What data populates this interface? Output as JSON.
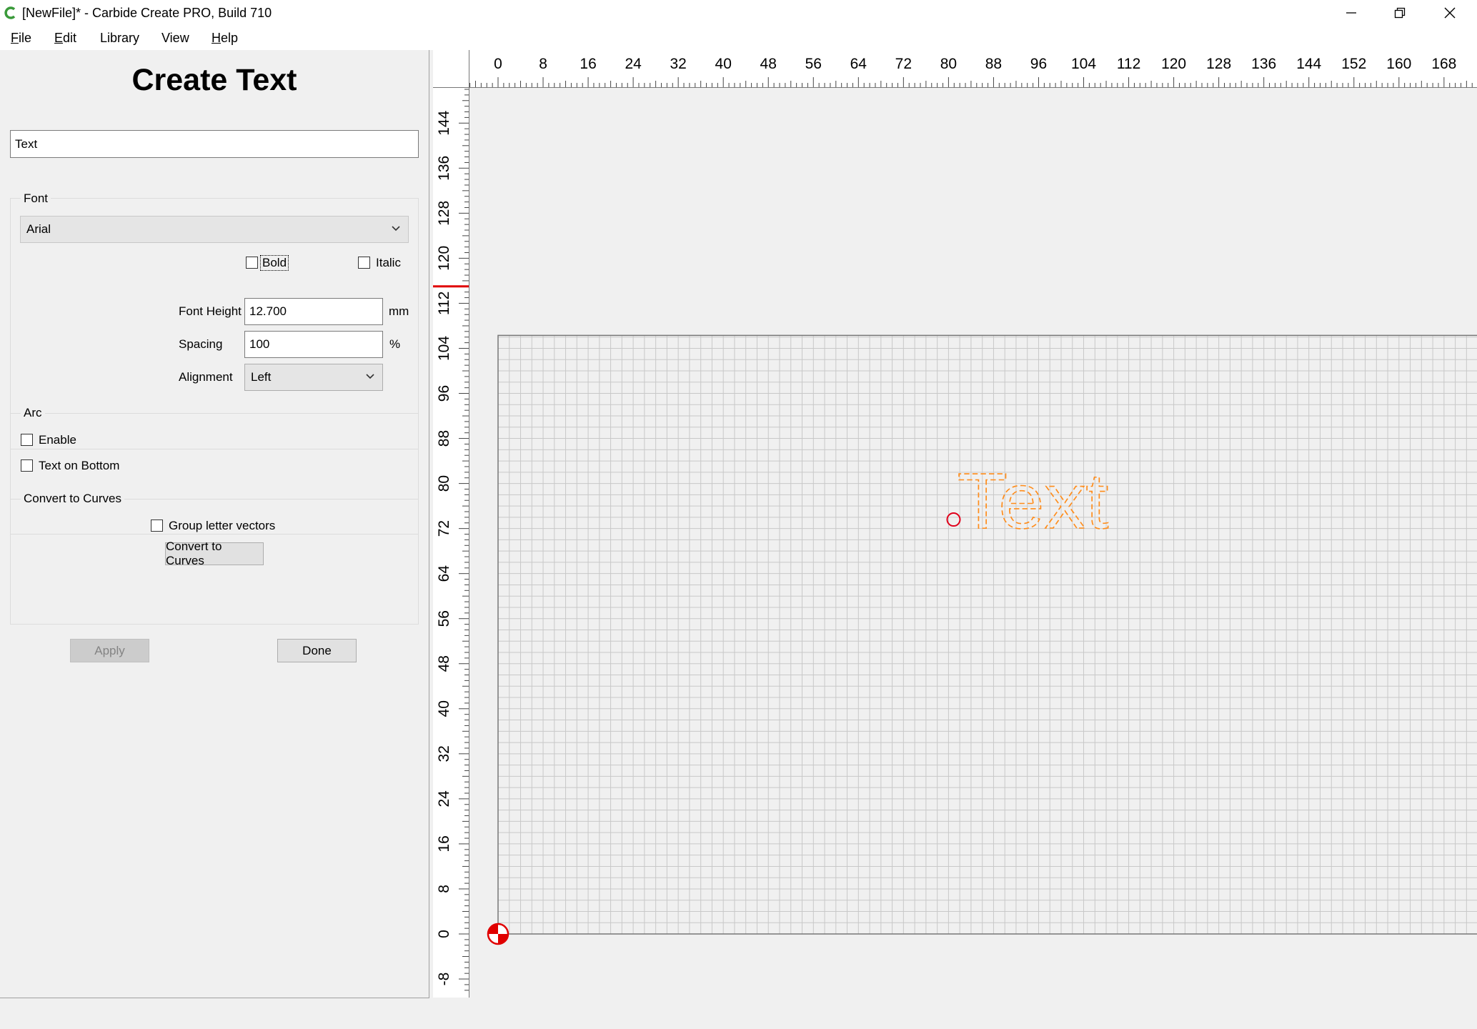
{
  "window": {
    "title": "[NewFile]* - Carbide Create PRO, Build 710",
    "app_icon": "carbide-c-icon",
    "controls": [
      "minimize-icon",
      "restore-icon",
      "close-icon"
    ]
  },
  "menu": [
    {
      "first": "F",
      "rest": "ile"
    },
    {
      "first": "E",
      "rest": "dit"
    },
    {
      "first": "",
      "rest": "Library"
    },
    {
      "first": "",
      "rest": "View"
    },
    {
      "first": "H",
      "rest": "elp"
    }
  ],
  "panel": {
    "title": "Create Text",
    "text_value": "Text",
    "font_group": {
      "title": "Font",
      "font_value": "Arial",
      "bold_label": "Bold",
      "bold_checked": false,
      "italic_label": "Italic",
      "italic_checked": false,
      "font_height_label": "Font Height",
      "font_height_value": "12.700",
      "font_height_unit": "mm",
      "spacing_label": "Spacing",
      "spacing_value": "100",
      "spacing_unit": "%",
      "alignment_label": "Alignment",
      "alignment_value": "Left"
    },
    "arc_group": {
      "title": "Arc",
      "enable_label": "Enable",
      "enable_checked": false,
      "text_on_bottom_label": "Text on Bottom",
      "text_on_bottom_checked": false
    },
    "curves_group": {
      "title": "Convert to Curves",
      "group_vectors_label": "Group letter vectors",
      "group_vectors_checked": false,
      "convert_button": "Convert to Curves"
    },
    "apply_button": "Apply",
    "done_button": "Done"
  },
  "canvas": {
    "units": "mm",
    "top_ruler_labels": [
      "0",
      "8",
      "16",
      "24",
      "32",
      "40",
      "48",
      "56",
      "64",
      "72",
      "80",
      "88",
      "96",
      "104",
      "112",
      "120",
      "128",
      "136",
      "144",
      "152",
      "160",
      "168"
    ],
    "left_ruler_labels": [
      "144",
      "136",
      "128",
      "120",
      "112",
      "104",
      "96",
      "88",
      "80",
      "72",
      "64",
      "56",
      "48",
      "40",
      "32",
      "24",
      "16",
      "8",
      "0",
      "-8"
    ],
    "cursor_y_marker": 115,
    "text_object": "Text",
    "text_anchor_mm": {
      "x": 80.9,
      "y": 73.6
    },
    "text_outline_color": "#ff8c1a",
    "anchor_color": "#e0001b",
    "origin_marker": "origin-icon",
    "grid_color": "#c8c8c8",
    "stock_border_color": "#777777"
  }
}
